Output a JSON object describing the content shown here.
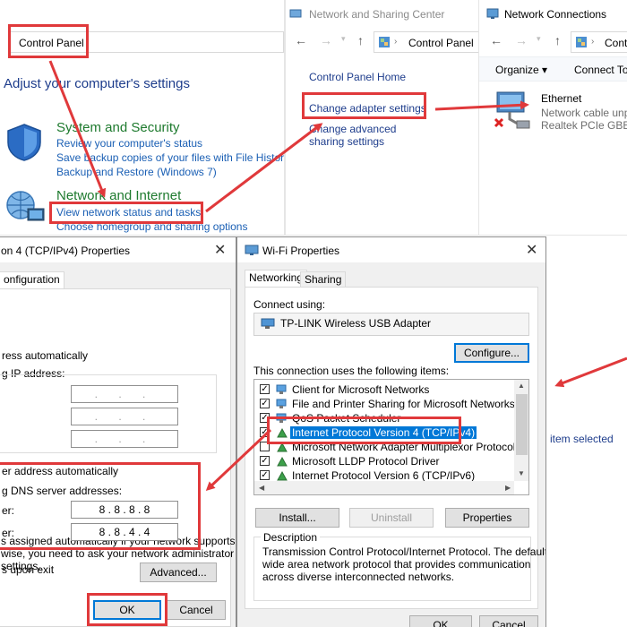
{
  "control_panel": {
    "address": "Control Panel",
    "heading": "Adjust your computer's settings",
    "system_security": {
      "title": "System and Security",
      "links": [
        "Review your computer's status",
        "Save backup copies of your files with File History",
        "Backup and Restore (Windows 7)"
      ]
    },
    "network_internet": {
      "title": "Network and Internet",
      "links": [
        "View network status and tasks",
        "Choose homegroup and sharing options"
      ]
    }
  },
  "network_sharing": {
    "title": "Network and Sharing Center",
    "address": "Control Panel",
    "links": [
      "Control Panel Home",
      "Change adapter settings",
      "Change advanced sharing settings"
    ]
  },
  "network_connections": {
    "title": "Network Connections",
    "address": "Cont",
    "toolbar": {
      "organize": "Organize ▾",
      "connect": "Connect To"
    },
    "adapter": {
      "name": "Ethernet",
      "status": "Network cable unp",
      "device": "Realtek PCIe GBE Fa"
    },
    "status": "item selected"
  },
  "ipv4_dialog": {
    "title": "on 4 (TCP/IPv4) Properties",
    "tab": "onfiguration",
    "desc": [
      "s assigned automatically if your network supports",
      "wise, you need to ask your network administrator",
      "settings."
    ],
    "obtain_ip": "ress automatically",
    "use_ip": "g IP address:",
    "ip_placeholder": ". . .",
    "obtain_dns": "er address automatically",
    "use_dns": "g DNS server addresses:",
    "preferred_label": "er:",
    "alternate_label": "er:",
    "preferred_dns": "8  .  8  .  8  .  8",
    "alternate_dns": "8  .  8  .  4  .  4",
    "validate": "s upon exit",
    "advanced": "Advanced...",
    "ok": "OK",
    "cancel": "Cancel"
  },
  "wifi_dialog": {
    "title": "Wi-Fi Properties",
    "tabs": [
      "Networking",
      "Sharing"
    ],
    "connect_using": "Connect using:",
    "adapter": "TP-LINK Wireless USB Adapter",
    "configure": "Configure...",
    "items_label": "This connection uses the following items:",
    "items": [
      "Client for Microsoft Networks",
      "File and Printer Sharing for Microsoft Networks",
      "QoS Packet Scheduler",
      "Internet Protocol Version 4 (TCP/IPv4)",
      "Microsoft Network Adapter Multiplexor Protocol",
      "Microsoft LLDP Protocol Driver",
      "Internet Protocol Version 6 (TCP/IPv6)"
    ],
    "install": "Install...",
    "uninstall": "Uninstall",
    "properties": "Properties",
    "description_title": "Description",
    "description": [
      "Transmission Control Protocol/Internet Protocol. The default",
      "wide area network protocol that provides communication",
      "across diverse interconnected networks."
    ],
    "ok": "OK",
    "cancel": "Cancel"
  },
  "colors": {
    "highlight": "#e0393b",
    "link": "#1a5fb4",
    "selection": "#0078d7"
  }
}
